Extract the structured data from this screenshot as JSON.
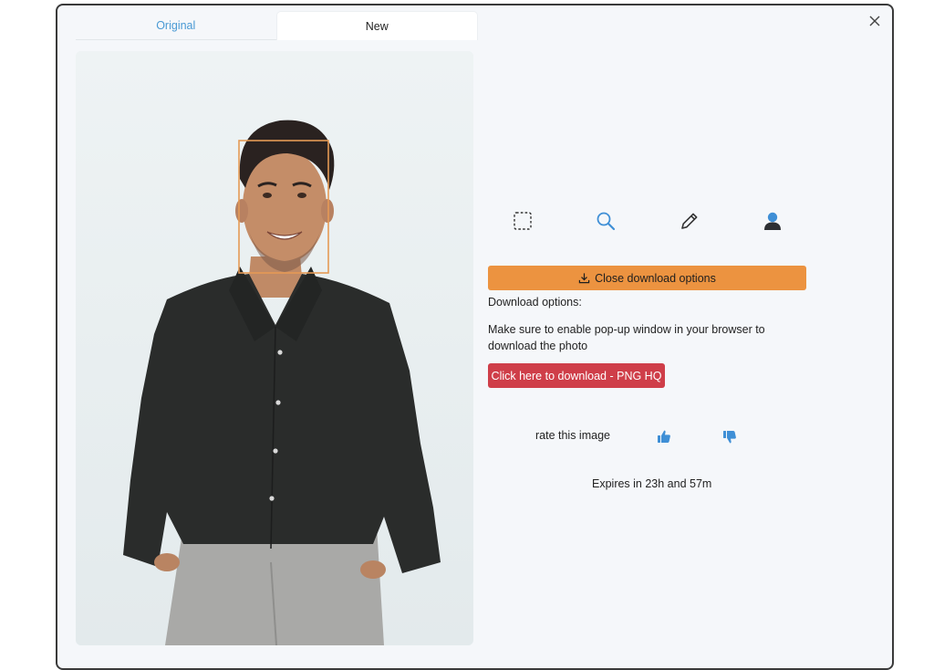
{
  "tabs": {
    "original": "Original",
    "new": "New"
  },
  "icons": {
    "close": "close-icon",
    "tools": [
      "crop-selection-icon",
      "magnifier-icon",
      "pencil-icon",
      "person-icon"
    ],
    "download": "download-icon",
    "thumbs_up": "thumbs-up-icon",
    "thumbs_down": "thumbs-down-icon"
  },
  "photo": {
    "description_icon": "person-photo",
    "face_box_color": "#e59a55"
  },
  "actions": {
    "close_download_label": "Close download options",
    "download_options_title": "Download options:",
    "popup_note": "Make sure to enable pop-up window in your browser to download the photo",
    "download_button_label": "Click here to download - PNG HQ"
  },
  "rating": {
    "label": "rate this image"
  },
  "expiry": {
    "text": "Expires in 23h and 57m"
  },
  "colors": {
    "accent_orange": "#ec9340",
    "download_red": "#cf3e49",
    "link_blue": "#4a9ad4",
    "icon_blue": "#3f8fd6"
  }
}
